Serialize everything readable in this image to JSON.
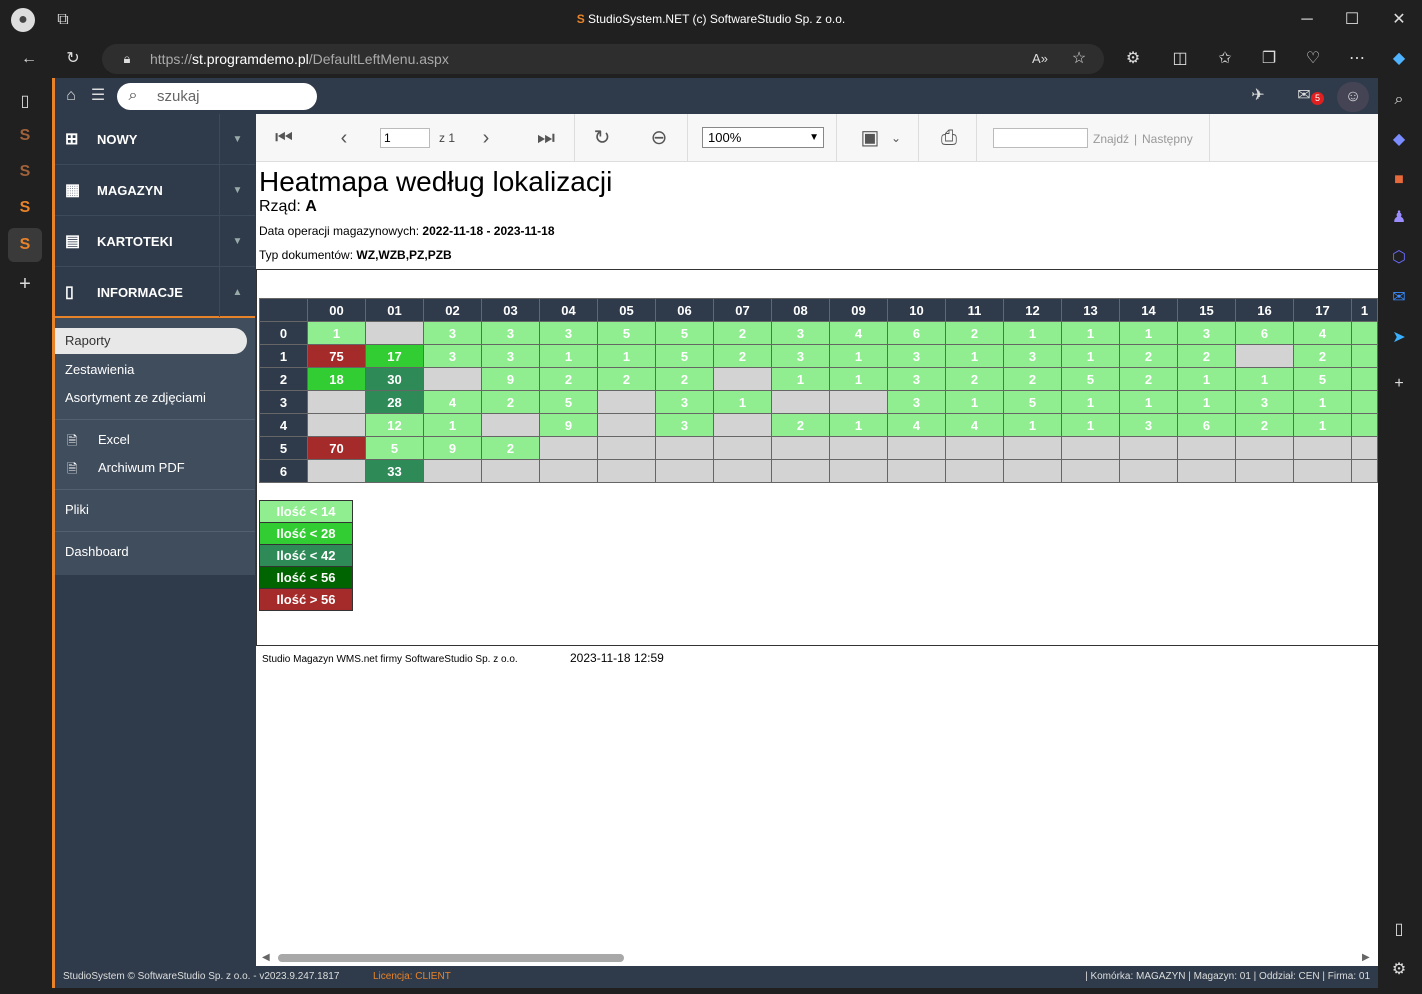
{
  "browser": {
    "title": "StudioSystem.NET (c) SoftwareStudio Sp. z o.o.",
    "url_prefix": "https://",
    "url_host": "st.programdemo.pl",
    "url_path": "/DefaultLeftMenu.aspx"
  },
  "app": {
    "search_placeholder": "szukaj",
    "mail_badge": "5"
  },
  "menu": {
    "items": [
      {
        "label": "NOWY"
      },
      {
        "label": "MAGAZYN"
      },
      {
        "label": "KARTOTEKI"
      },
      {
        "label": "INFORMACJE"
      }
    ],
    "sub": {
      "raporty": "Raporty",
      "zestawienia": "Zestawienia",
      "asortyment": "Asortyment ze zdjęciami",
      "excel": "Excel",
      "pdf": "Archiwum PDF",
      "pliki": "Pliki",
      "dashboard": "Dashboard"
    }
  },
  "toolbar": {
    "page": "1",
    "of": "z 1",
    "zoom": "100%",
    "find": "Znajdź",
    "sep": "|",
    "next": "Następny"
  },
  "report": {
    "title": "Heatmapa według lokalizacji",
    "row_label": "Rząd:",
    "row_value": "A",
    "dates_label": "Data operacji magazynowych:",
    "dates_value": "2022-11-18 - 2023-11-18",
    "doc_label": "Typ dokumentów:",
    "doc_value": "WZ,WZB,PZ,PZB",
    "footer_company": "Studio Magazyn WMS.net firmy SoftwareStudio Sp. z o.o.",
    "footer_date": "2023-11-18 12:59"
  },
  "colors": {
    "empty": "#d3d3d3",
    "lt14": "#90ee90",
    "lt28": "#32cd32",
    "lt42": "#2e8b57",
    "lt56": "#006400",
    "gt56": "#a52a2a"
  },
  "heatmap": {
    "columns": [
      "00",
      "01",
      "02",
      "03",
      "04",
      "05",
      "06",
      "07",
      "08",
      "09",
      "10",
      "11",
      "12",
      "13",
      "14",
      "15",
      "16",
      "17",
      "1"
    ],
    "rows": [
      {
        "label": "0",
        "cells": [
          "1",
          "",
          "3",
          "3",
          "3",
          "5",
          "5",
          "2",
          "3",
          "4",
          "6",
          "2",
          "1",
          "1",
          "1",
          "3",
          "6",
          "4",
          ""
        ]
      },
      {
        "label": "1",
        "cells": [
          "75",
          "17",
          "3",
          "3",
          "1",
          "1",
          "5",
          "2",
          "3",
          "1",
          "3",
          "1",
          "3",
          "1",
          "2",
          "2",
          "",
          "2",
          ""
        ]
      },
      {
        "label": "2",
        "cells": [
          "18",
          "30",
          "",
          "9",
          "2",
          "2",
          "2",
          "",
          "1",
          "1",
          "3",
          "2",
          "2",
          "5",
          "2",
          "1",
          "1",
          "5",
          ""
        ]
      },
      {
        "label": "3",
        "cells": [
          "",
          "28",
          "4",
          "2",
          "5",
          "",
          "3",
          "1",
          "",
          "",
          "3",
          "1",
          "5",
          "1",
          "1",
          "1",
          "3",
          "1",
          ""
        ]
      },
      {
        "label": "4",
        "cells": [
          "",
          "12",
          "1",
          "",
          "9",
          "",
          "3",
          "",
          "2",
          "1",
          "4",
          "4",
          "1",
          "1",
          "3",
          "6",
          "2",
          "1",
          ""
        ]
      },
      {
        "label": "5",
        "cells": [
          "70",
          "5",
          "9",
          "2",
          "",
          "",
          "",
          "",
          "",
          "",
          "",
          "",
          "",
          "",
          "",
          "",
          "",
          "",
          ""
        ]
      },
      {
        "label": "6",
        "cells": [
          "",
          "33",
          "",
          "",
          "",
          "",
          "",
          "",
          "",
          "",
          "",
          "",
          "",
          "",
          "",
          "",
          "",
          "",
          ""
        ]
      }
    ],
    "empty_filled_row0_last": true
  },
  "legend": [
    "Ilość < 14",
    "Ilość < 28",
    "Ilość < 42",
    "Ilość < 56",
    "Ilość > 56"
  ],
  "statusbar": {
    "left": "StudioSystem © SoftwareStudio Sp. z o.o. - v2023.9.247.1817",
    "license": "Licencja: CLIENT",
    "right": "| Komórka: MAGAZYN | Magazyn: 01 | Oddział: CEN | Firma: 01"
  }
}
